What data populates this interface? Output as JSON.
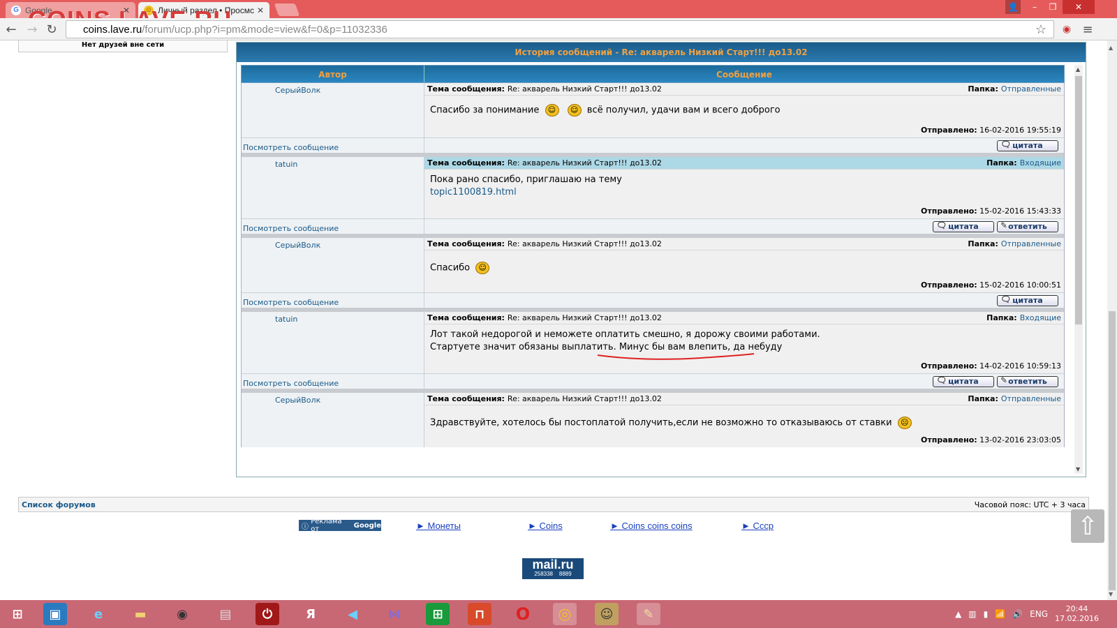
{
  "browser": {
    "tabs": [
      {
        "title": "Google",
        "active": false
      },
      {
        "title": "Личный раздел • Просмс",
        "active": true
      }
    ],
    "watermark": "COINS.LAVE.RU",
    "url_host": "coins.lave.ru",
    "url_path": "/forum/ucp.php?i=pm&mode=view&f=0&p=11032336"
  },
  "friends_box": "Нет друзей вне сети",
  "history": {
    "title": "История сообщений - Re: акварель Низкий Старт!!! до13.02",
    "col_author": "Автор",
    "col_message": "Сообщение",
    "subject_label": "Тема сообщения:",
    "folder_label": "Папка:",
    "sent_label": "Отправлено:",
    "view_label": "Посмотреть сообщение",
    "quote_label": "цитата",
    "reply_label": "ответить",
    "messages": [
      {
        "author": "СерыйВолк",
        "subject": "Re: акварель Низкий Старт!!! до13.02",
        "folder": "Отправленные",
        "text1": "Спасибо за понимание",
        "text2": "всё получил, удачи вам и всего доброго",
        "link": "",
        "sent": "16-02-2016 19:55:19"
      },
      {
        "author": "tatuin",
        "subject": "Re: акварель Низкий Старт!!! до13.02",
        "folder": "Входящие",
        "text1": "Пока рано спасибо, приглашаю на тему",
        "text2": "",
        "link": "topic1100819.html",
        "sent": "15-02-2016 15:43:33"
      },
      {
        "author": "СерыйВолк",
        "subject": "Re: акварель Низкий Старт!!! до13.02",
        "folder": "Отправленные",
        "text1": "Спасибо",
        "text2": "",
        "link": "",
        "sent": "15-02-2016 10:00:51"
      },
      {
        "author": "tatuin",
        "subject": "Re: акварель Низкий Старт!!! до13.02",
        "folder": "Входящие",
        "text1": "Лот такой недорогой и неможете оплатить смешно, я дорожу своими работами.",
        "text2": "Стартуете значит обязаны выплатить. Минус бы вам влепить, да небуду",
        "link": "",
        "sent": "14-02-2016 10:59:13"
      },
      {
        "author": "СерыйВолк",
        "subject": "Re: акварель Низкий Старт!!! до13.02",
        "folder": "Отправленные",
        "text1": "Здравствуйте, хотелось бы постоплатой получить,если не возможно то отказываюсь от ставки",
        "text2": "",
        "link": "",
        "sent": "13-02-2016 23:03:05"
      }
    ]
  },
  "footer": {
    "forum_list": "Список форумов",
    "timezone": "Часовой пояс: UTC + 3 часа"
  },
  "ads": {
    "badge": "Реклама от",
    "badge_brand": "Google",
    "links": [
      "► Монеты",
      "► Coins",
      "► Coins coins coins",
      "► Cccp"
    ]
  },
  "mailru": {
    "logo": "mail.ru",
    "count1": "258338",
    "count2": "8889"
  },
  "taskbar": {
    "lang": "ENG",
    "time": "20:44",
    "date": "17.02.2016"
  }
}
